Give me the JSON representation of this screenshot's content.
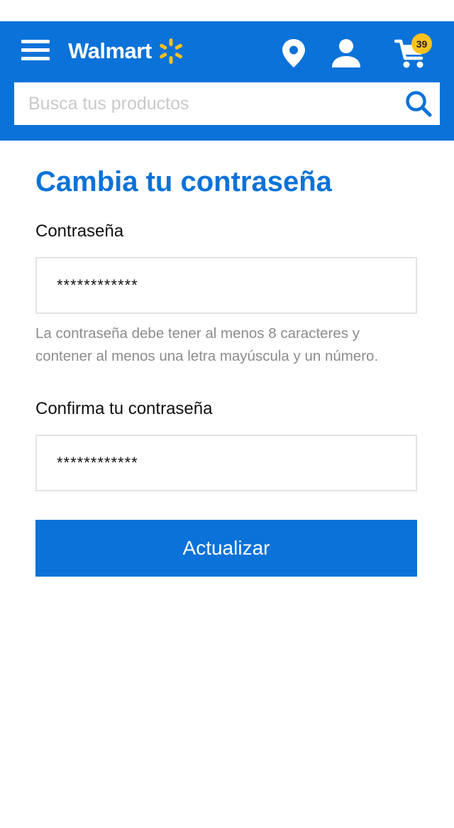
{
  "header": {
    "brand": "Walmart",
    "cart_count": "39",
    "search": {
      "placeholder": "Busca tus productos",
      "value": ""
    }
  },
  "form": {
    "title": "Cambia tu contraseña",
    "password": {
      "label": "Contraseña",
      "value": "************"
    },
    "hint": "La contraseña debe tener al menos 8 caracteres y contener al menos una letra mayúscula y un número.",
    "confirm": {
      "label": "Confirma tu contraseña",
      "value": "************"
    },
    "submit_label": "Actualizar"
  },
  "colors": {
    "brand_blue": "#0a72d8",
    "spark_yellow": "#ffc220",
    "hint_gray": "#8c8c8c"
  },
  "icons": [
    "menu-icon",
    "walmart-spark-icon",
    "location-pin-icon",
    "account-icon",
    "cart-icon",
    "search-icon"
  ]
}
